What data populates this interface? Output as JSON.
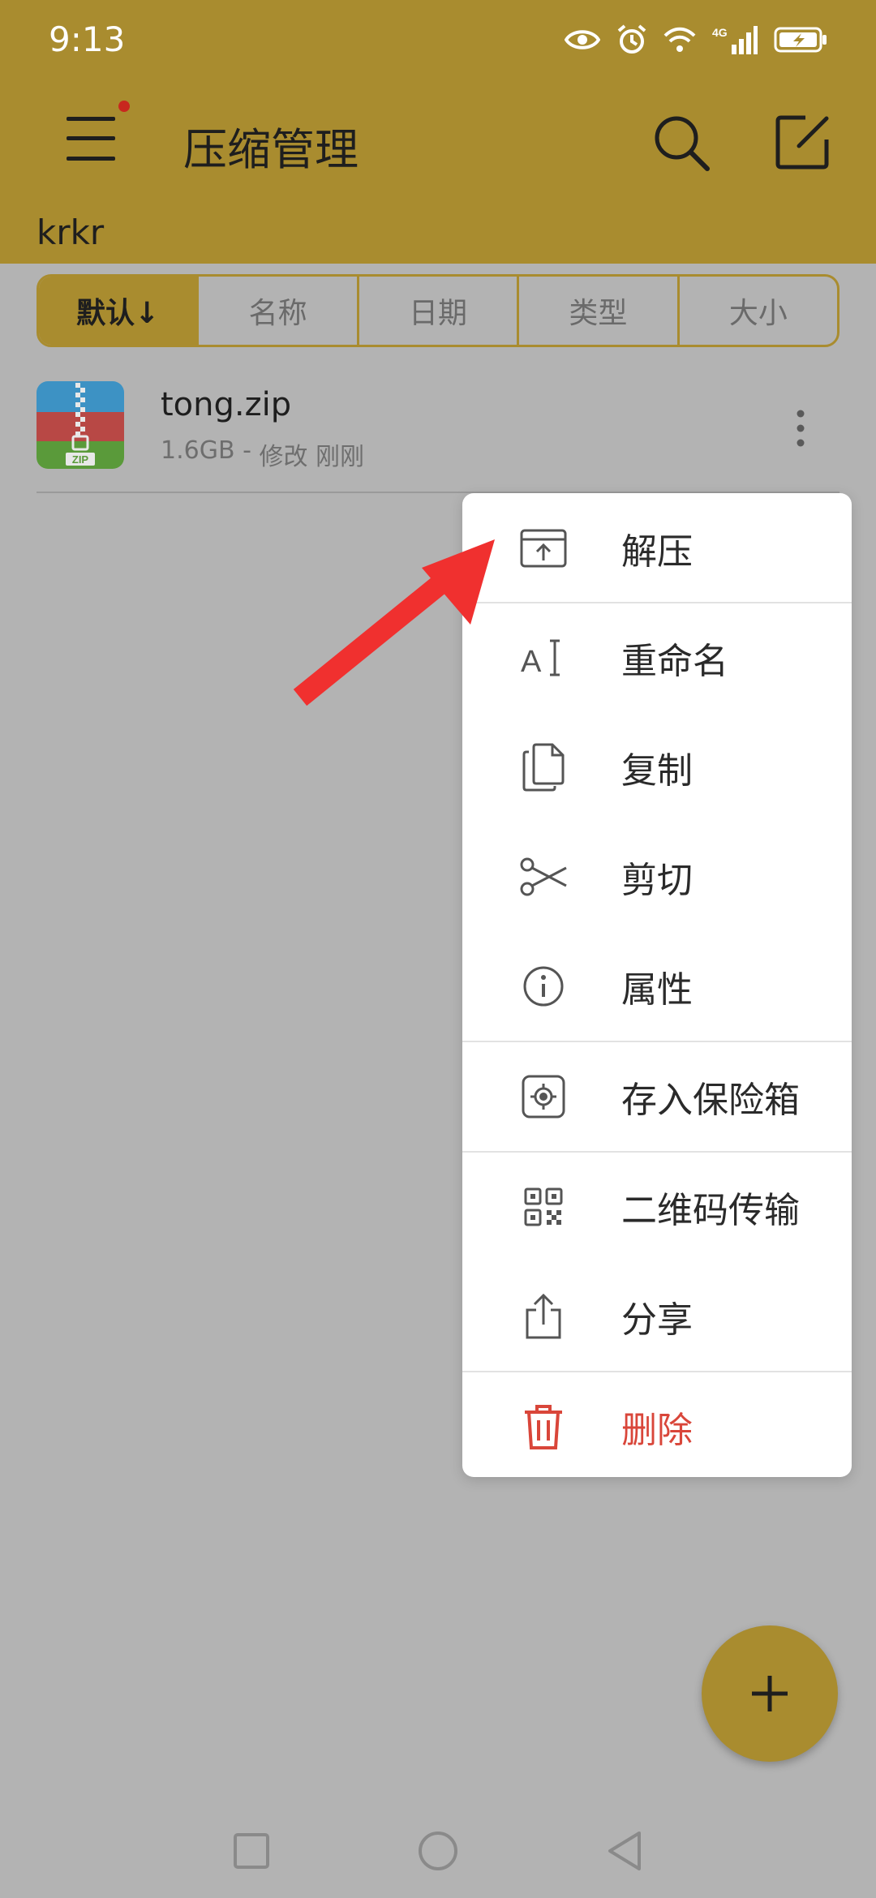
{
  "status": {
    "time": "9:13",
    "network": "4G"
  },
  "header": {
    "title": "压缩管理",
    "path": "krkr"
  },
  "sort_tabs": [
    {
      "label": "默认↓",
      "active": true
    },
    {
      "label": "名称",
      "active": false
    },
    {
      "label": "日期",
      "active": false
    },
    {
      "label": "类型",
      "active": false
    },
    {
      "label": "大小",
      "active": false
    }
  ],
  "file": {
    "name": "tong.zip",
    "size": "1.6GB",
    "separator": " - ",
    "modified": "修改 刚刚",
    "badge": "ZIP"
  },
  "context_menu": {
    "items": [
      {
        "label": "解压",
        "icon": "extract-icon"
      },
      {
        "label": "重命名",
        "icon": "rename-icon"
      },
      {
        "label": "复制",
        "icon": "copy-icon"
      },
      {
        "label": "剪切",
        "icon": "scissors-icon"
      },
      {
        "label": "属性",
        "icon": "info-icon"
      },
      {
        "label": "存入保险箱",
        "icon": "safe-icon"
      },
      {
        "label": "二维码传输",
        "icon": "qr-code-icon"
      },
      {
        "label": "分享",
        "icon": "share-icon"
      },
      {
        "label": "删除",
        "icon": "trash-icon"
      }
    ]
  },
  "colors": {
    "accent": "#a98c2f",
    "danger": "#d9463a",
    "overlay_bg": "#b3b3b3",
    "arrow": "#f0302f"
  }
}
